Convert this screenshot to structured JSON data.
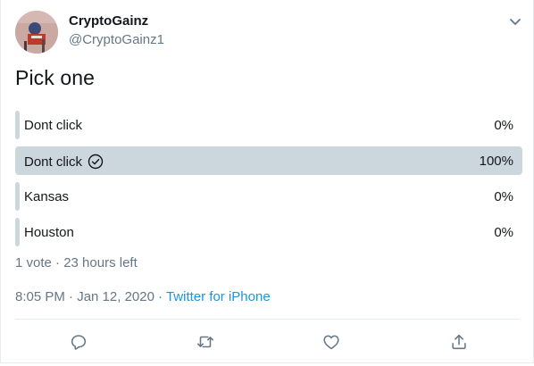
{
  "author": {
    "display_name": "CryptoGainz",
    "handle": "@CryptoGainz1",
    "avatar_icon": "avatar-photo"
  },
  "tweet": {
    "text": "Pick one"
  },
  "poll": {
    "options": [
      {
        "label": "Dont click",
        "percent_label": "0%",
        "percent": 0,
        "selected": false
      },
      {
        "label": "Dont click",
        "percent_label": "100%",
        "percent": 100,
        "selected": true
      },
      {
        "label": "Kansas",
        "percent_label": "0%",
        "percent": 0,
        "selected": false
      },
      {
        "label": "Houston",
        "percent_label": "0%",
        "percent": 0,
        "selected": false
      }
    ],
    "meta": "1 vote · 23 hours left"
  },
  "timestamp": {
    "time": "8:05 PM · Jan 12, 2020",
    "separator": "·",
    "source": "Twitter for iPhone"
  },
  "actions": {
    "reply_icon": "reply-icon",
    "retweet_icon": "retweet-icon",
    "like_icon": "like-icon",
    "share_icon": "share-icon"
  },
  "colors": {
    "bar": "#ccd6dd",
    "muted_text": "#657786",
    "link": "#1b95e0",
    "text": "#14171a"
  }
}
